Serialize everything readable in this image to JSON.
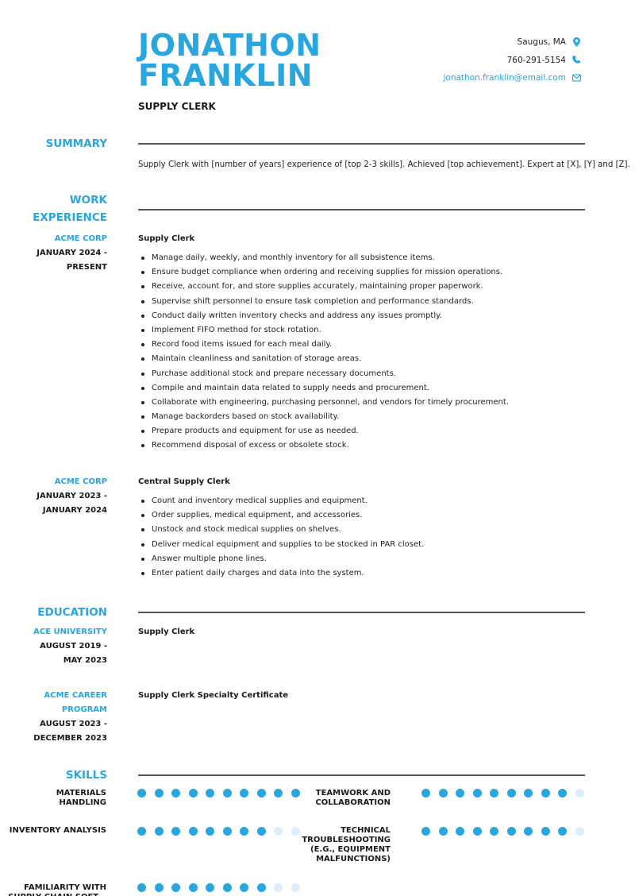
{
  "header": {
    "first_name": "JONATHON",
    "last_name": "FRANKLIN",
    "job_title": "SUPPLY CLERK",
    "contact": {
      "location": "Saugus, MA",
      "phone": "760-291-5154",
      "email": "jonathon.franklin@email.com"
    }
  },
  "icons": {
    "location": "map-pin-icon",
    "phone": "phone-icon",
    "email": "envelope-icon"
  },
  "colors": {
    "accent": "#2aa6df",
    "dot_inactive": "#dbeef9",
    "rule": "#555555"
  },
  "summary": {
    "title": "SUMMARY",
    "text": "Supply Clerk with [number of years] experience of [top 2-3 skills]. Achieved [top achievement]. Expert at [X], [Y] and [Z]."
  },
  "work": {
    "title_line1": "WORK",
    "title_line2": "EXPERIENCE",
    "jobs": [
      {
        "company": "ACME CORP",
        "dates_line1": "JANUARY 2024 -",
        "dates_line2": "PRESENT",
        "role": "Supply Clerk",
        "bullets": [
          "Manage daily, weekly, and monthly inventory for all subsistence items.",
          "Ensure budget compliance when ordering and receiving supplies for mission operations.",
          "Receive, account for, and store supplies accurately, maintaining proper paperwork.",
          "Supervise shift personnel to ensure task completion and performance standards.",
          "Conduct daily written inventory checks and address any issues promptly.",
          "Implement FIFO method for stock rotation.",
          "Record food items issued for each meal daily.",
          "Maintain cleanliness and sanitation of storage areas.",
          "Purchase additional stock and prepare necessary documents.",
          "Compile and maintain data related to supply needs and procurement.",
          "Collaborate with engineering, purchasing personnel, and vendors for timely procurement.",
          "Manage backorders based on stock availability.",
          "Prepare products and equipment for use as needed.",
          "Recommend disposal of excess or obsolete stock."
        ]
      },
      {
        "company": "ACME CORP",
        "dates_line1": "JANUARY 2023 -",
        "dates_line2": "JANUARY 2024",
        "role": "Central Supply Clerk",
        "bullets": [
          "Count and inventory medical supplies and equipment.",
          "Order supplies, medical equipment, and accessories.",
          "Unstock and stock medical supplies on shelves.",
          "Deliver medical equipment and supplies to be stocked in PAR closet.",
          "Answer multiple phone lines.",
          "Enter patient daily charges and data into the system."
        ]
      }
    ]
  },
  "education": {
    "title": "EDUCATION",
    "items": [
      {
        "school_line1": "ACE UNIVERSITY",
        "school_line2": "",
        "dates_line1": "AUGUST 2019 -",
        "dates_line2": "MAY 2023",
        "degree": "Supply Clerk"
      },
      {
        "school_line1": "ACME CAREER",
        "school_line2": "PROGRAM",
        "dates_line1": "AUGUST 2023 -",
        "dates_line2": "DECEMBER 2023",
        "degree": "Supply Clerk Specialty Certificate"
      }
    ]
  },
  "skills": {
    "title": "SKILLS",
    "max_level": 10,
    "items": [
      {
        "lines": [
          "MATERIALS",
          "HANDLING"
        ],
        "level": 10
      },
      {
        "lines": [
          "TEAMWORK AND",
          "COLLABORATION"
        ],
        "level": 9
      },
      {
        "lines": [
          "INVENTORY ANALYSIS"
        ],
        "level": 8
      },
      {
        "lines": [
          "TECHNICAL",
          "TROUBLESHOOTING",
          "(E.G., EQUIPMENT",
          "MALFUNCTIONS)"
        ],
        "level": 9
      },
      {
        "lines": [
          "FAMILIARITY WITH",
          "SUPPLY CHAIN SOFT..."
        ],
        "level": 8
      }
    ]
  }
}
